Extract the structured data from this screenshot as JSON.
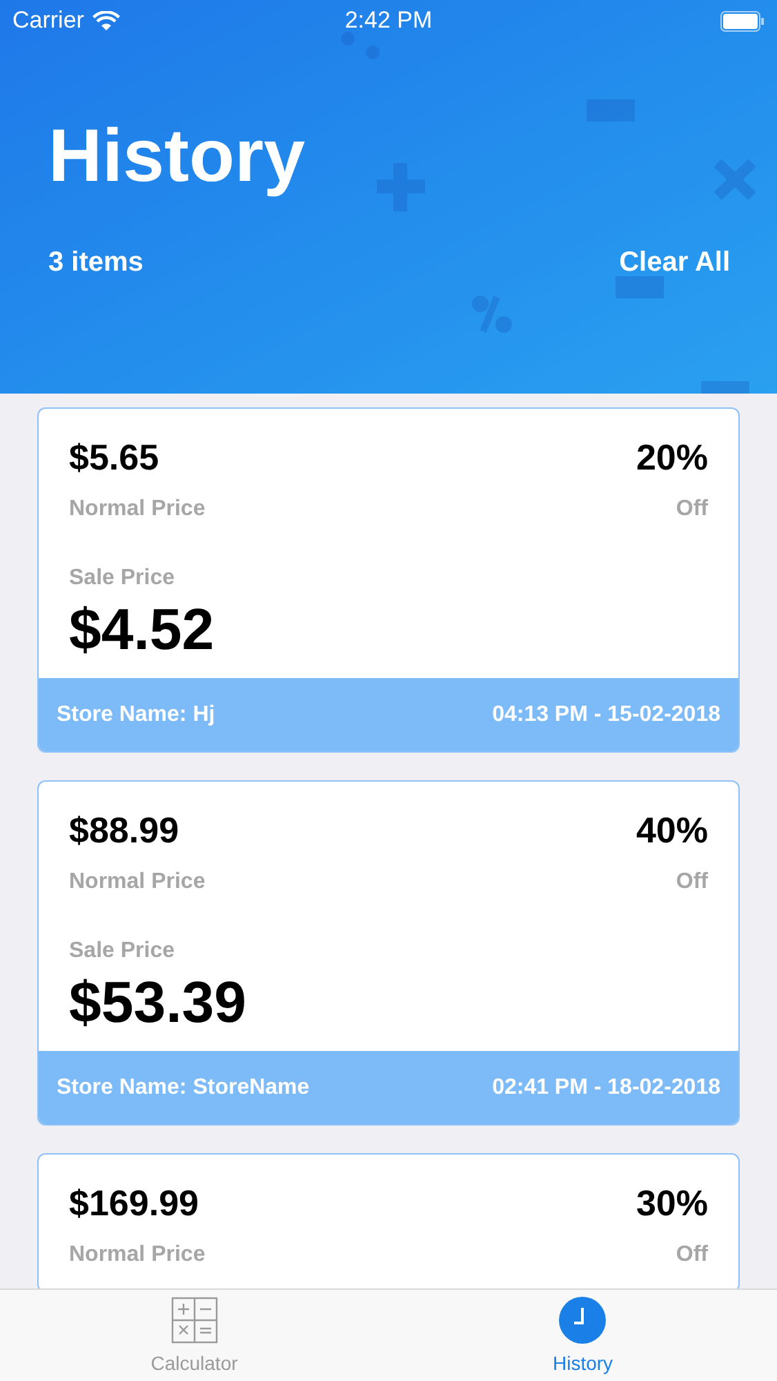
{
  "status_bar": {
    "carrier": "Carrier",
    "time": "2:42 PM"
  },
  "header": {
    "title": "History",
    "count": "3 items",
    "clear_button": "Clear All"
  },
  "cards": [
    {
      "normal_price": "$5.65",
      "normal_label": "Normal Price",
      "discount": "20%",
      "discount_label": "Off",
      "sale_label": "Sale Price",
      "sale_price": "$4.52",
      "store": "Store Name: Hj",
      "date": "04:13 PM - 15-02-2018"
    },
    {
      "normal_price": "$88.99",
      "normal_label": "Normal Price",
      "discount": "40%",
      "discount_label": "Off",
      "sale_label": "Sale Price",
      "sale_price": "$53.39",
      "store": "Store Name: StoreName",
      "date": "02:41 PM - 18-02-2018"
    },
    {
      "normal_price": "$169.99",
      "normal_label": "Normal Price",
      "discount": "30%",
      "discount_label": "Off"
    }
  ],
  "tabs": [
    {
      "label": "Calculator",
      "kind": "calculator",
      "selected": false
    },
    {
      "label": "History",
      "kind": "history",
      "selected": true
    }
  ]
}
